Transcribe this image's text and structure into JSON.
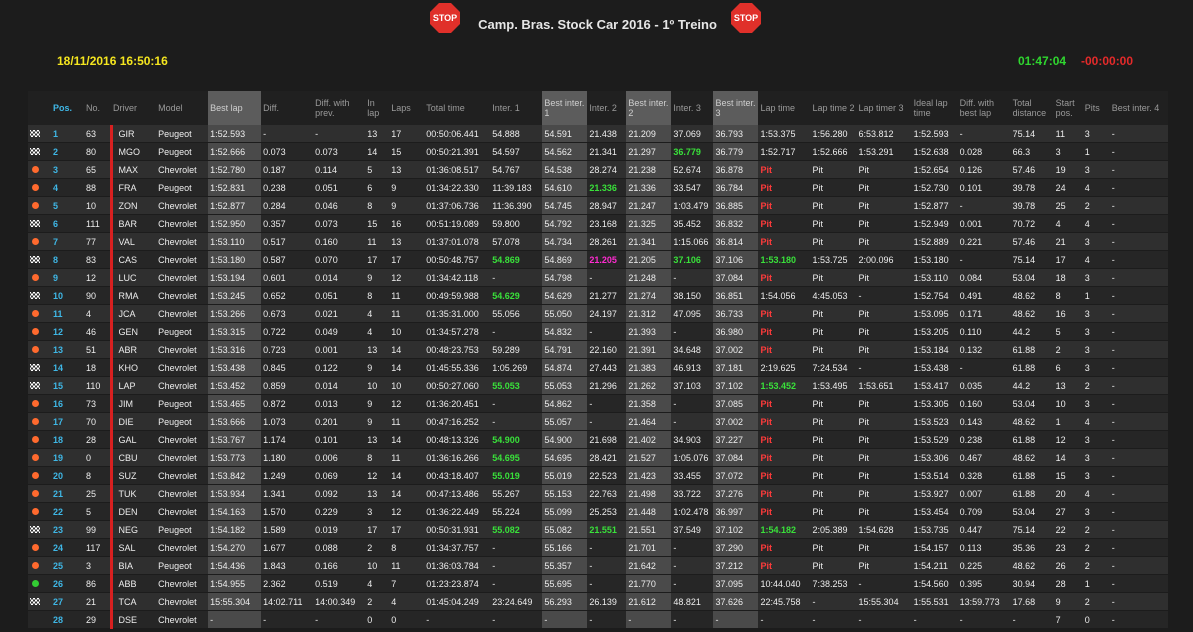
{
  "header": {
    "title": "Camp. Bras. Stock Car 2016 - 1º Treino",
    "stop_label": "STOP",
    "datetime": "18/11/2016 16:50:16",
    "clock": "01:47:04",
    "remaining": "-00:00:00"
  },
  "colors": {
    "pos": "#3fb7e6",
    "best": "#39e13a",
    "overall_best": "#ff2bd0",
    "pit": "#ff3b3b",
    "date": "#f5e61f"
  },
  "columns": [
    "",
    "Pos.",
    "No.",
    "Driver",
    "Model",
    "Best lap",
    "Diff.",
    "Diff. with prev.",
    "In lap",
    "Laps",
    "Total time",
    "Inter. 1",
    "Best inter. 1",
    "Inter. 2",
    "Best inter. 2",
    "Inter. 3",
    "Best inter. 3",
    "Lap time",
    "Lap time 2",
    "Lap timer 3",
    "Ideal lap time",
    "Diff. with best lap",
    "Total distance",
    "Start pos.",
    "Pits",
    "Best inter. 4"
  ],
  "rows": [
    [
      "flag",
      "1",
      "63",
      "GIR",
      "Peugeot",
      "1:52.593",
      "-",
      "-",
      "13",
      "17",
      "00:50:06.441",
      "54.888",
      "54.591",
      "21.438",
      "21.209",
      "37.069",
      "36.793",
      "1:53.375",
      "1:56.280",
      "6:53.812",
      "1:52.593",
      "-",
      "75.14",
      "11",
      "3",
      "-"
    ],
    [
      "flag",
      "2",
      "80",
      "MGO",
      "Peugeot",
      "1:52.666",
      "0.073",
      "0.073",
      "14",
      "15",
      "00:50:21.391",
      "54.597",
      "54.562",
      "21.341",
      "21.297",
      "36.779",
      "36.779",
      "1:52.717",
      "1:52.666",
      "1:53.291",
      "1:52.638",
      "0.028",
      "66.3",
      "3",
      "1",
      "-"
    ],
    [
      "dot",
      "3",
      "65",
      "MAX",
      "Chevrolet",
      "1:52.780",
      "0.187",
      "0.114",
      "5",
      "13",
      "01:36:08.517",
      "54.767",
      "54.538",
      "28.274",
      "21.238",
      "52.674",
      "36.878",
      "Pit",
      "Pit",
      "Pit",
      "1:52.654",
      "0.126",
      "57.46",
      "19",
      "3",
      "-"
    ],
    [
      "dot",
      "4",
      "88",
      "FRA",
      "Peugeot",
      "1:52.831",
      "0.238",
      "0.051",
      "6",
      "9",
      "01:34:22.330",
      "11:39.183",
      "54.610",
      "21.336",
      "21.336",
      "33.547",
      "36.784",
      "Pit",
      "Pit",
      "Pit",
      "1:52.730",
      "0.101",
      "39.78",
      "24",
      "4",
      "-"
    ],
    [
      "dot",
      "5",
      "10",
      "ZON",
      "Chevrolet",
      "1:52.877",
      "0.284",
      "0.046",
      "8",
      "9",
      "01:37:06.736",
      "11:36.390",
      "54.745",
      "28.947",
      "21.247",
      "1:03.479",
      "36.885",
      "Pit",
      "Pit",
      "Pit",
      "1:52.877",
      "-",
      "39.78",
      "25",
      "2",
      "-"
    ],
    [
      "flag",
      "6",
      "111",
      "BAR",
      "Chevrolet",
      "1:52.950",
      "0.357",
      "0.073",
      "15",
      "16",
      "00:51:19.089",
      "59.800",
      "54.792",
      "23.168",
      "21.325",
      "35.452",
      "36.832",
      "Pit",
      "Pit",
      "Pit",
      "1:52.949",
      "0.001",
      "70.72",
      "4",
      "4",
      "-"
    ],
    [
      "dot",
      "7",
      "77",
      "VAL",
      "Chevrolet",
      "1:53.110",
      "0.517",
      "0.160",
      "11",
      "13",
      "01:37:01.078",
      "57.078",
      "54.734",
      "28.261",
      "21.341",
      "1:15.066",
      "36.814",
      "Pit",
      "Pit",
      "Pit",
      "1:52.889",
      "0.221",
      "57.46",
      "21",
      "3",
      "-"
    ],
    [
      "flag",
      "8",
      "83",
      "CAS",
      "Chevrolet",
      "1:53.180",
      "0.587",
      "0.070",
      "17",
      "17",
      "00:50:48.757",
      "54.869",
      "54.869",
      "21.205",
      "21.205",
      "37.106",
      "37.106",
      "1:53.180",
      "1:53.725",
      "2:00.096",
      "1:53.180",
      "-",
      "75.14",
      "17",
      "4",
      "-"
    ],
    [
      "dot",
      "9",
      "12",
      "LUC",
      "Chevrolet",
      "1:53.194",
      "0.601",
      "0.014",
      "9",
      "12",
      "01:34:42.118",
      "-",
      "54.798",
      "-",
      "21.248",
      "-",
      "37.084",
      "Pit",
      "Pit",
      "Pit",
      "1:53.110",
      "0.084",
      "53.04",
      "18",
      "3",
      "-"
    ],
    [
      "flag",
      "10",
      "90",
      "RMA",
      "Chevrolet",
      "1:53.245",
      "0.652",
      "0.051",
      "8",
      "11",
      "00:49:59.988",
      "54.629",
      "54.629",
      "21.277",
      "21.274",
      "38.150",
      "36.851",
      "1:54.056",
      "4:45.053",
      "-",
      "1:52.754",
      "0.491",
      "48.62",
      "8",
      "1",
      "-"
    ],
    [
      "dot",
      "11",
      "4",
      "JCA",
      "Chevrolet",
      "1:53.266",
      "0.673",
      "0.021",
      "4",
      "11",
      "01:35:31.000",
      "55.056",
      "55.050",
      "24.197",
      "21.312",
      "47.095",
      "36.733",
      "Pit",
      "Pit",
      "Pit",
      "1:53.095",
      "0.171",
      "48.62",
      "16",
      "3",
      "-"
    ],
    [
      "dot",
      "12",
      "46",
      "GEN",
      "Peugeot",
      "1:53.315",
      "0.722",
      "0.049",
      "4",
      "10",
      "01:34:57.278",
      "-",
      "54.832",
      "-",
      "21.393",
      "-",
      "36.980",
      "Pit",
      "Pit",
      "Pit",
      "1:53.205",
      "0.110",
      "44.2",
      "5",
      "3",
      "-"
    ],
    [
      "dot",
      "13",
      "51",
      "ABR",
      "Chevrolet",
      "1:53.316",
      "0.723",
      "0.001",
      "13",
      "14",
      "00:48:23.753",
      "59.289",
      "54.791",
      "22.160",
      "21.391",
      "34.648",
      "37.002",
      "Pit",
      "Pit",
      "Pit",
      "1:53.184",
      "0.132",
      "61.88",
      "2",
      "3",
      "-"
    ],
    [
      "flag",
      "14",
      "18",
      "KHO",
      "Chevrolet",
      "1:53.438",
      "0.845",
      "0.122",
      "9",
      "14",
      "01:45:55.336",
      "1:05.269",
      "54.874",
      "27.443",
      "21.383",
      "46.913",
      "37.181",
      "2:19.625",
      "7:24.534",
      "-",
      "1:53.438",
      "-",
      "61.88",
      "6",
      "3",
      "-"
    ],
    [
      "flag",
      "15",
      "110",
      "LAP",
      "Chevrolet",
      "1:53.452",
      "0.859",
      "0.014",
      "10",
      "10",
      "00:50:27.060",
      "55.053",
      "55.053",
      "21.296",
      "21.262",
      "37.103",
      "37.102",
      "1:53.452",
      "1:53.495",
      "1:53.651",
      "1:53.417",
      "0.035",
      "44.2",
      "13",
      "2",
      "-"
    ],
    [
      "dot",
      "16",
      "73",
      "JIM",
      "Peugeot",
      "1:53.465",
      "0.872",
      "0.013",
      "9",
      "12",
      "01:36:20.451",
      "-",
      "54.862",
      "-",
      "21.358",
      "-",
      "37.085",
      "Pit",
      "Pit",
      "Pit",
      "1:53.305",
      "0.160",
      "53.04",
      "10",
      "3",
      "-"
    ],
    [
      "dot",
      "17",
      "70",
      "DIE",
      "Peugeot",
      "1:53.666",
      "1.073",
      "0.201",
      "9",
      "11",
      "00:47:16.252",
      "-",
      "55.057",
      "-",
      "21.464",
      "-",
      "37.002",
      "Pit",
      "Pit",
      "Pit",
      "1:53.523",
      "0.143",
      "48.62",
      "1",
      "4",
      "-"
    ],
    [
      "dot",
      "18",
      "28",
      "GAL",
      "Chevrolet",
      "1:53.767",
      "1.174",
      "0.101",
      "13",
      "14",
      "00:48:13.326",
      "54.900",
      "54.900",
      "21.698",
      "21.402",
      "34.903",
      "37.227",
      "Pit",
      "Pit",
      "Pit",
      "1:53.529",
      "0.238",
      "61.88",
      "12",
      "3",
      "-"
    ],
    [
      "dot",
      "19",
      "0",
      "CBU",
      "Chevrolet",
      "1:53.773",
      "1.180",
      "0.006",
      "8",
      "11",
      "01:36:16.266",
      "54.695",
      "54.695",
      "28.421",
      "21.527",
      "1:05.076",
      "37.084",
      "Pit",
      "Pit",
      "Pit",
      "1:53.306",
      "0.467",
      "48.62",
      "14",
      "3",
      "-"
    ],
    [
      "dot",
      "20",
      "8",
      "SUZ",
      "Chevrolet",
      "1:53.842",
      "1.249",
      "0.069",
      "12",
      "14",
      "00:43:18.407",
      "55.019",
      "55.019",
      "22.523",
      "21.423",
      "33.455",
      "37.072",
      "Pit",
      "Pit",
      "Pit",
      "1:53.514",
      "0.328",
      "61.88",
      "15",
      "3",
      "-"
    ],
    [
      "dot",
      "21",
      "25",
      "TUK",
      "Chevrolet",
      "1:53.934",
      "1.341",
      "0.092",
      "13",
      "14",
      "00:47:13.486",
      "55.267",
      "55.153",
      "22.763",
      "21.498",
      "33.722",
      "37.276",
      "Pit",
      "Pit",
      "Pit",
      "1:53.927",
      "0.007",
      "61.88",
      "20",
      "4",
      "-"
    ],
    [
      "dot",
      "22",
      "5",
      "DEN",
      "Chevrolet",
      "1:54.163",
      "1.570",
      "0.229",
      "3",
      "12",
      "01:36:22.449",
      "55.224",
      "55.099",
      "25.253",
      "21.448",
      "1:02.478",
      "36.997",
      "Pit",
      "Pit",
      "Pit",
      "1:53.454",
      "0.709",
      "53.04",
      "27",
      "3",
      "-"
    ],
    [
      "flag",
      "23",
      "99",
      "NEG",
      "Peugeot",
      "1:54.182",
      "1.589",
      "0.019",
      "17",
      "17",
      "00:50:31.931",
      "55.082",
      "55.082",
      "21.551",
      "21.551",
      "37.549",
      "37.102",
      "1:54.182",
      "2:05.389",
      "1:54.628",
      "1:53.735",
      "0.447",
      "75.14",
      "22",
      "2",
      "-"
    ],
    [
      "dot",
      "24",
      "117",
      "SAL",
      "Chevrolet",
      "1:54.270",
      "1.677",
      "0.088",
      "2",
      "8",
      "01:34:37.757",
      "-",
      "55.166",
      "-",
      "21.701",
      "-",
      "37.290",
      "Pit",
      "Pit",
      "Pit",
      "1:54.157",
      "0.113",
      "35.36",
      "23",
      "2",
      "-"
    ],
    [
      "dot",
      "25",
      "3",
      "BIA",
      "Peugeot",
      "1:54.436",
      "1.843",
      "0.166",
      "10",
      "11",
      "01:36:03.784",
      "-",
      "55.357",
      "-",
      "21.642",
      "-",
      "37.212",
      "Pit",
      "Pit",
      "Pit",
      "1:54.211",
      "0.225",
      "48.62",
      "26",
      "2",
      "-"
    ],
    [
      "green",
      "26",
      "86",
      "ABB",
      "Chevrolet",
      "1:54.955",
      "2.362",
      "0.519",
      "4",
      "7",
      "01:23:23.874",
      "-",
      "55.695",
      "-",
      "21.770",
      "-",
      "37.095",
      "10:44.040",
      "7:38.253",
      "-",
      "1:54.560",
      "0.395",
      "30.94",
      "28",
      "1",
      "-"
    ],
    [
      "flag",
      "27",
      "21",
      "TCA",
      "Chevrolet",
      "15:55.304",
      "14:02.711",
      "14:00.349",
      "2",
      "4",
      "01:45:04.249",
      "23:24.649",
      "56.293",
      "26.139",
      "21.612",
      "48.821",
      "37.626",
      "22:45.758",
      "-",
      "15:55.304",
      "1:55.531",
      "13:59.773",
      "17.68",
      "9",
      "2",
      "-"
    ],
    [
      "none",
      "28",
      "29",
      "DSE",
      "Chevrolet",
      "-",
      "-",
      "-",
      "0",
      "0",
      "-",
      "-",
      "-",
      "-",
      "-",
      "-",
      "-",
      "-",
      "-",
      "-",
      "-",
      "-",
      "-",
      "7",
      "0",
      "-"
    ]
  ],
  "highlights": {
    "green": [
      [
        1,
        15
      ],
      [
        3,
        13
      ],
      [
        7,
        11
      ],
      [
        7,
        15
      ],
      [
        7,
        17
      ],
      [
        9,
        11
      ],
      [
        14,
        11
      ],
      [
        14,
        17
      ],
      [
        17,
        11
      ],
      [
        18,
        11
      ],
      [
        19,
        11
      ],
      [
        22,
        11
      ],
      [
        22,
        13
      ],
      [
        22,
        17
      ]
    ],
    "magenta": [
      [
        7,
        13
      ]
    ]
  }
}
